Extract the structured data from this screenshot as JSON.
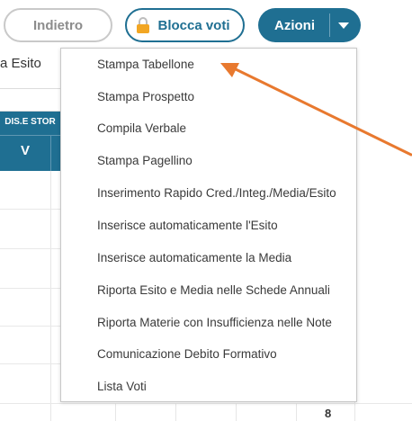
{
  "toolbar": {
    "back_label": "Indietro",
    "lock_label": "Blocca voti",
    "actions_label": "Azioni"
  },
  "background": {
    "section_label": "a Esito",
    "column_header_top": "DIS.E STOR",
    "column_header_sub": "V",
    "cell_value": "8"
  },
  "menu": {
    "items": [
      "Stampa Tabellone",
      "Stampa Prospetto",
      "Compila Verbale",
      "Stampa Pagellino",
      "Inserimento Rapido Cred./Integ./Media/Esito",
      "Inserisce automaticamente l'Esito",
      "Inserisce automaticamente la Media",
      "Riporta Esito e Media nelle Schede Annuali",
      "Riporta Materie con Insufficienza nelle Note",
      "Comunicazione Debito Formativo",
      "Lista Voti"
    ]
  },
  "colors": {
    "accent": "#1f6f92",
    "arrow": "#e8792f",
    "lock": "#f2a623"
  },
  "icons": {
    "lock": "lock-icon",
    "caret": "chevron-down-icon",
    "annotation": "arrow-icon"
  }
}
